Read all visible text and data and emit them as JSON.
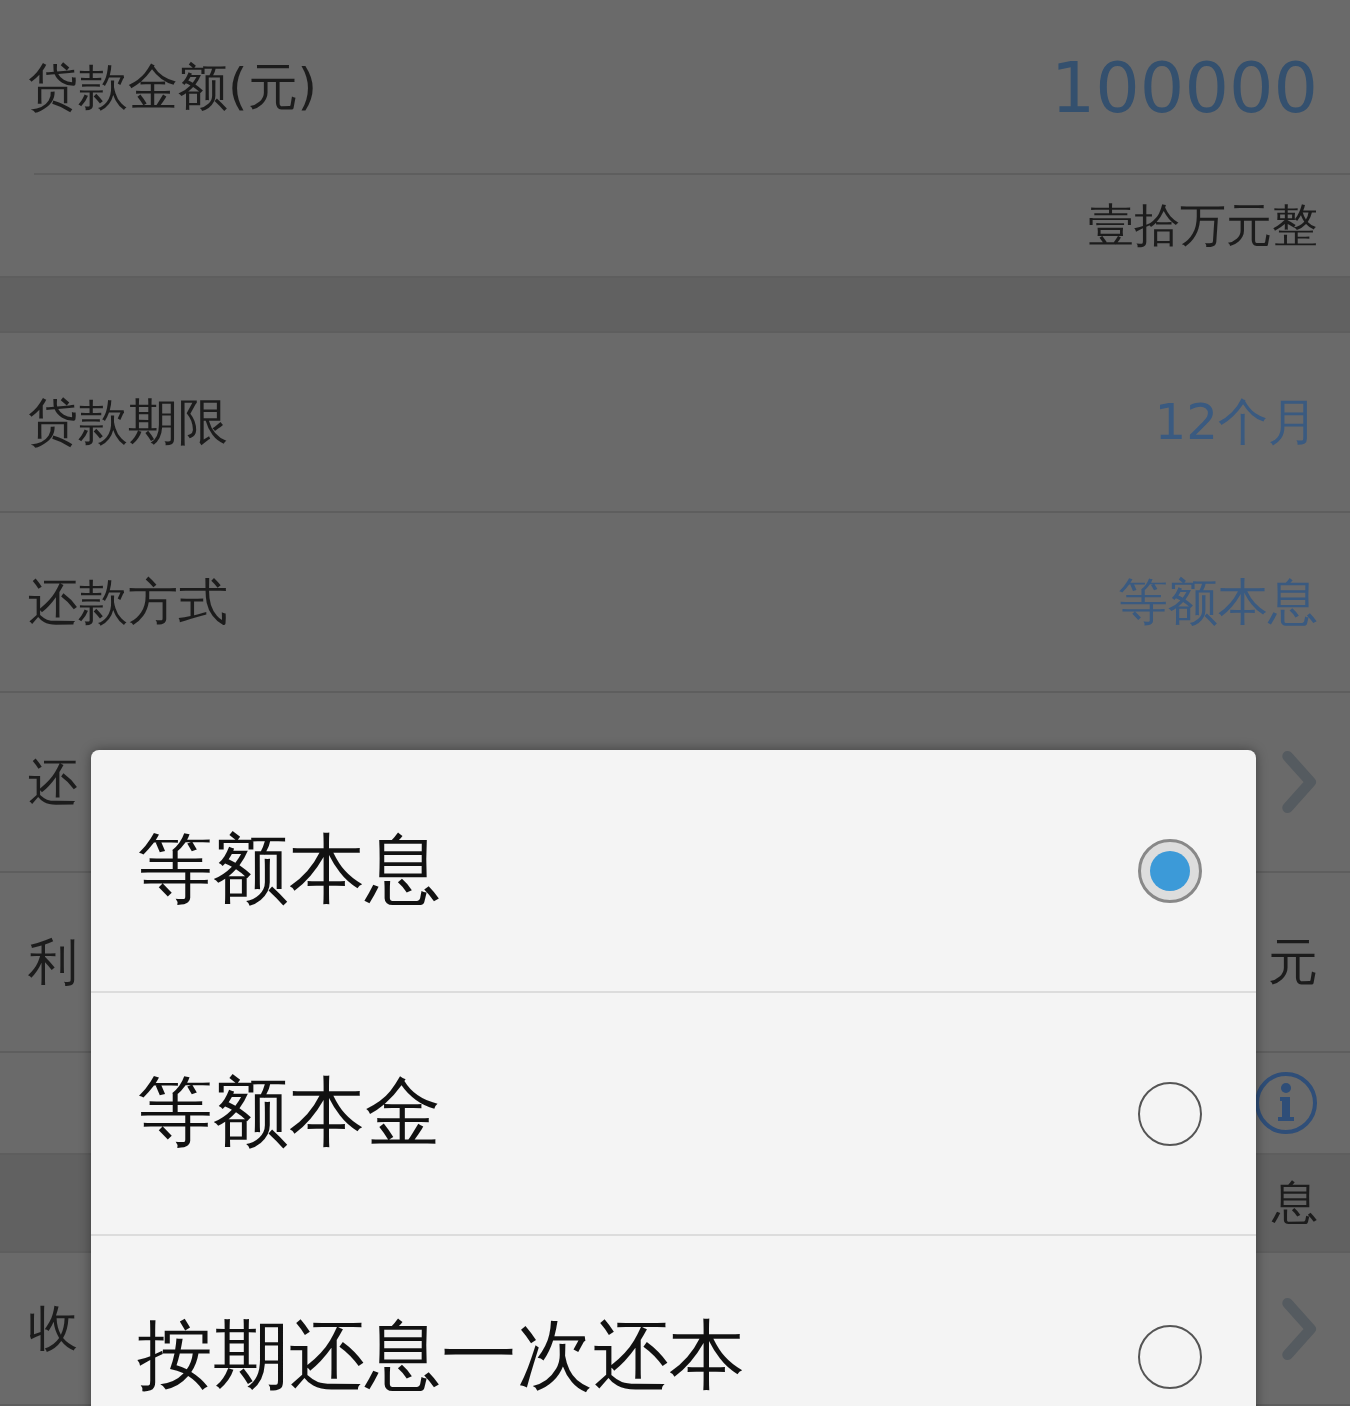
{
  "form": {
    "rows": [
      {
        "kind": "amount",
        "label": "贷款金额(元)",
        "value": "100000"
      },
      {
        "kind": "caption",
        "value": "壹拾万元整"
      },
      {
        "kind": "spacer"
      },
      {
        "kind": "field",
        "label": "贷款期限",
        "value": "12个月"
      },
      {
        "kind": "field",
        "label": "还款方式",
        "value": "等额本息"
      },
      {
        "kind": "link",
        "label": "还"
      },
      {
        "kind": "total",
        "label": "利",
        "value": "元"
      },
      {
        "kind": "info"
      },
      {
        "kind": "band",
        "value": "息"
      },
      {
        "kind": "link",
        "label": "收"
      }
    ]
  },
  "dialog": {
    "options": [
      {
        "label": "等额本息",
        "selected": true
      },
      {
        "label": "等额本金",
        "selected": false
      },
      {
        "label": "按期还息一次还本",
        "selected": false
      }
    ]
  }
}
